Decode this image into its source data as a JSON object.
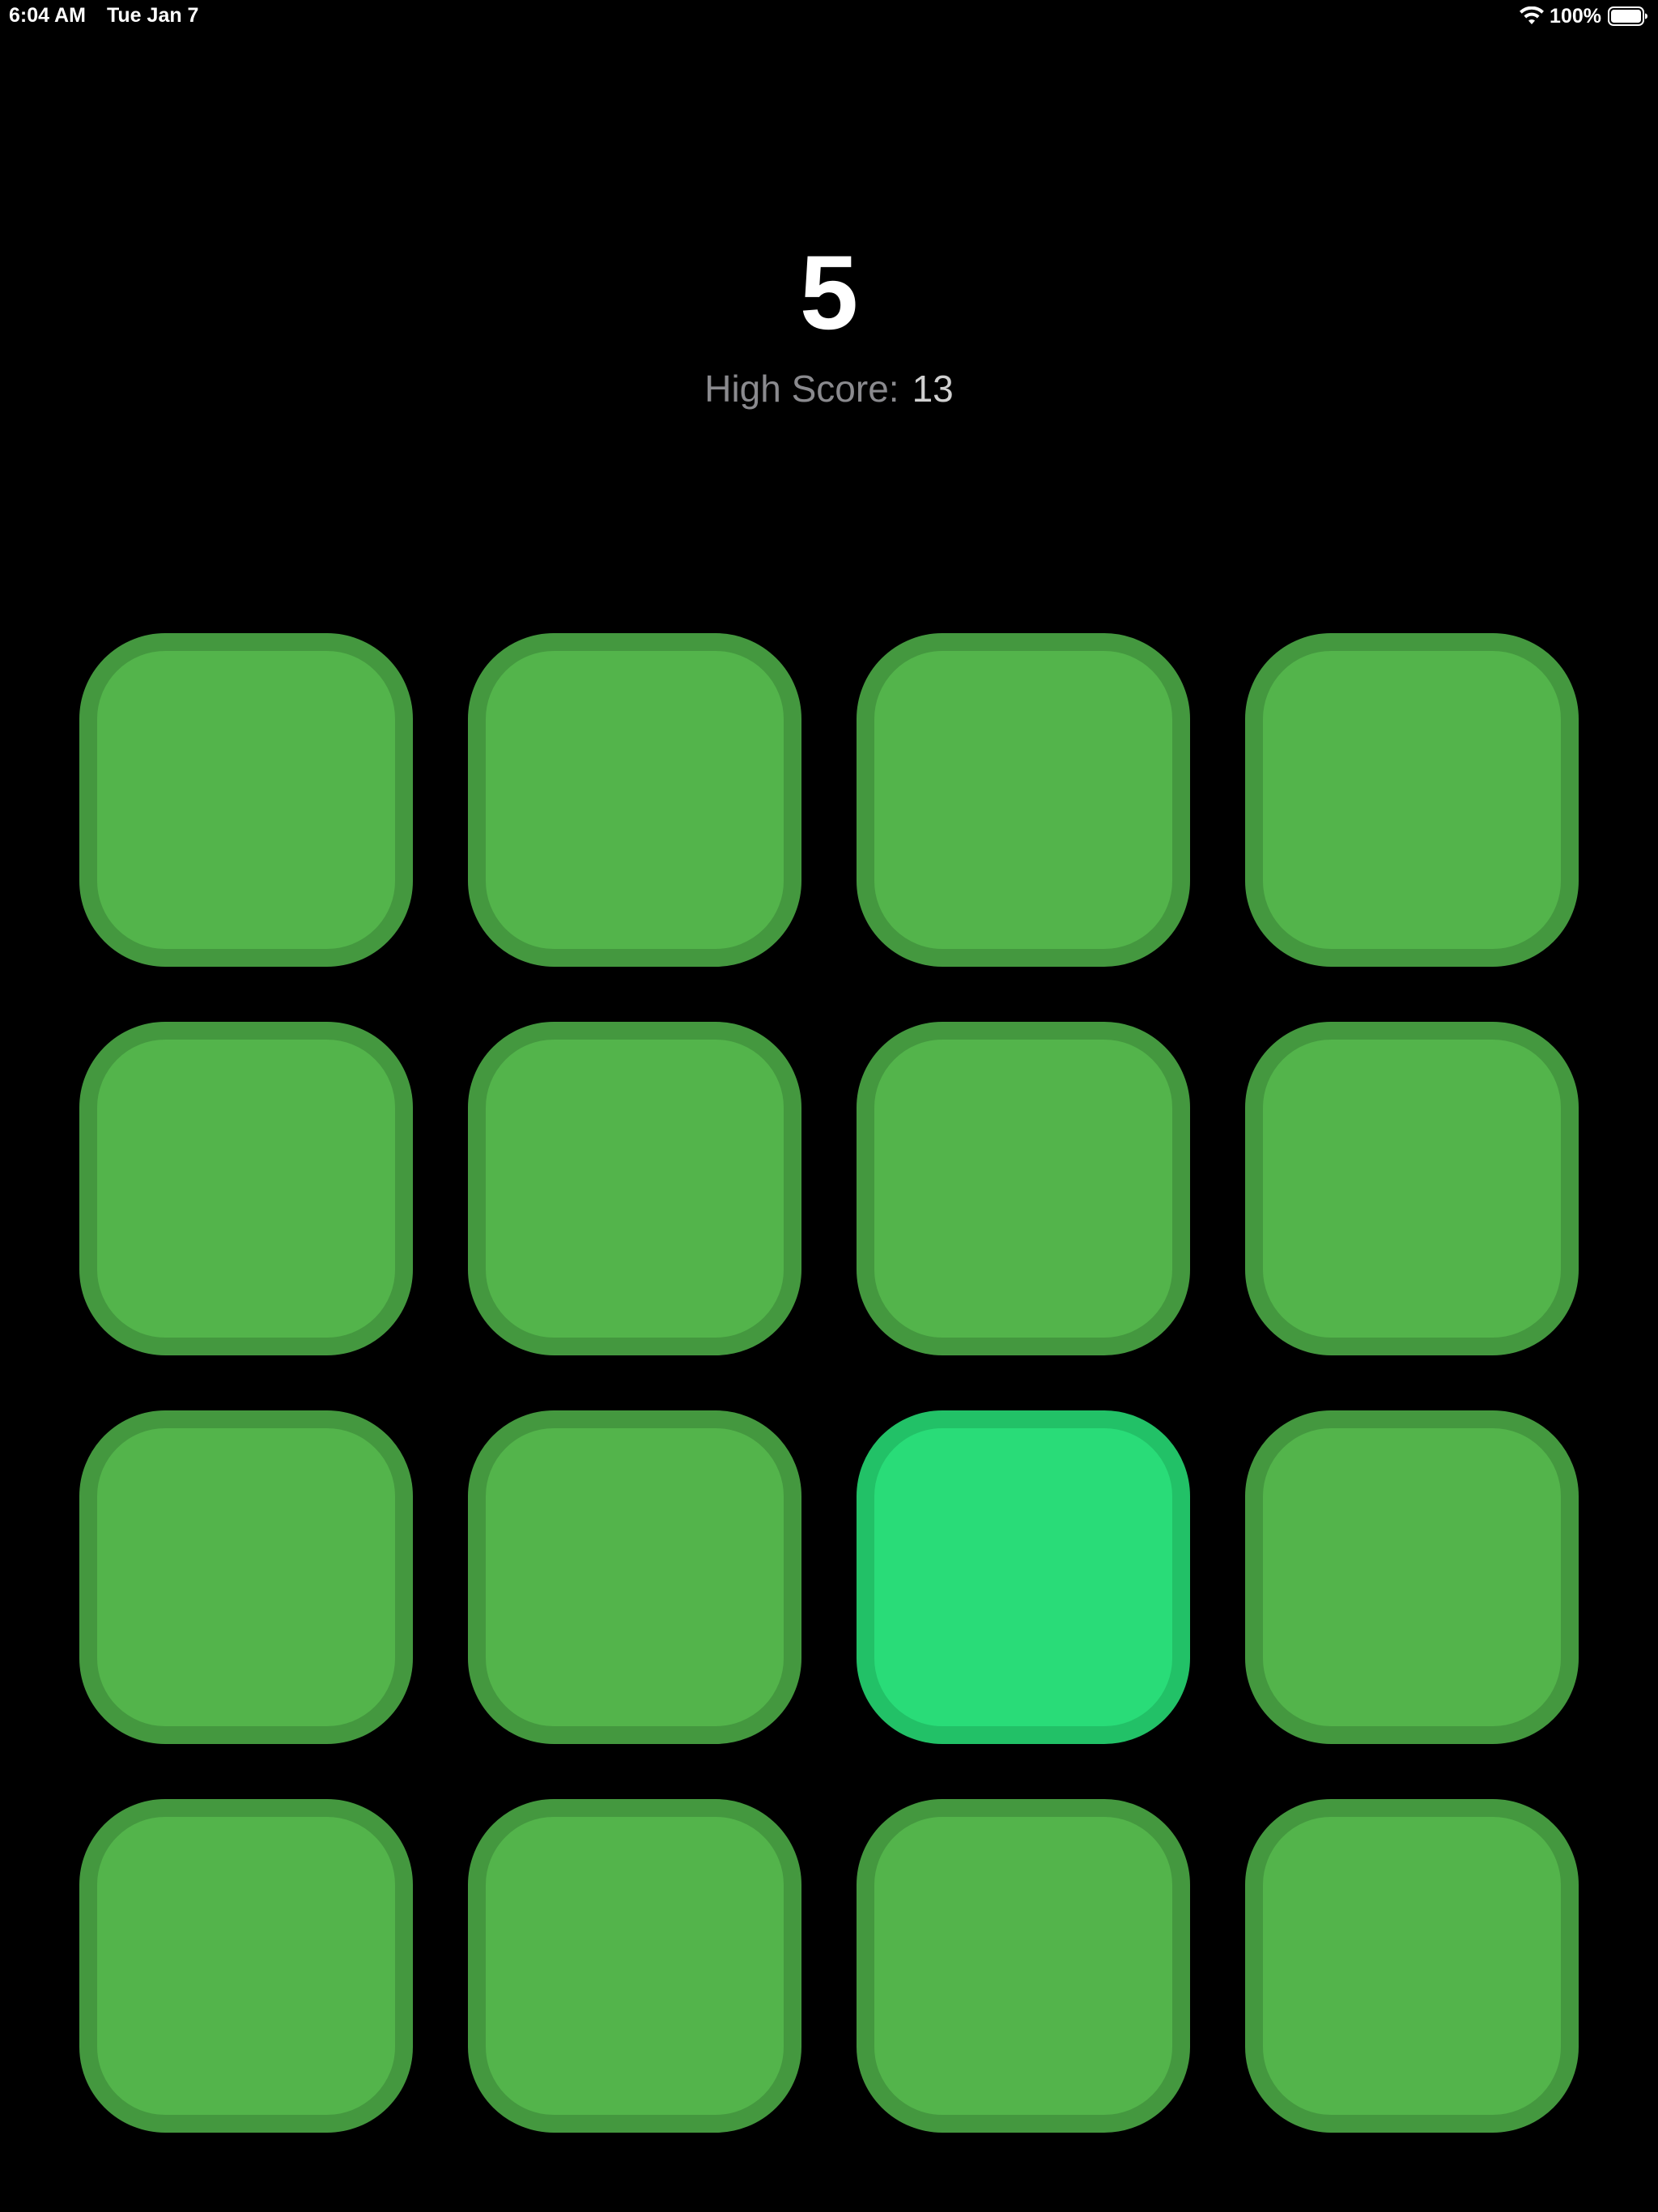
{
  "status_bar": {
    "time": "6:04 AM",
    "date": "Tue Jan 7",
    "battery": "100%",
    "wifi_icon": "wifi-icon",
    "battery_icon": "battery-full-icon"
  },
  "game": {
    "score": "5",
    "high_score_label": "High Score:",
    "high_score_value": "13"
  },
  "board": {
    "rows": 4,
    "columns": 4,
    "tile_color": "#53b44b",
    "tile_border_color": "#44983f",
    "lit_color": "#29dc78",
    "lit_border_color": "#22c167",
    "lit_tile": {
      "row": 3,
      "column": 3
    }
  }
}
